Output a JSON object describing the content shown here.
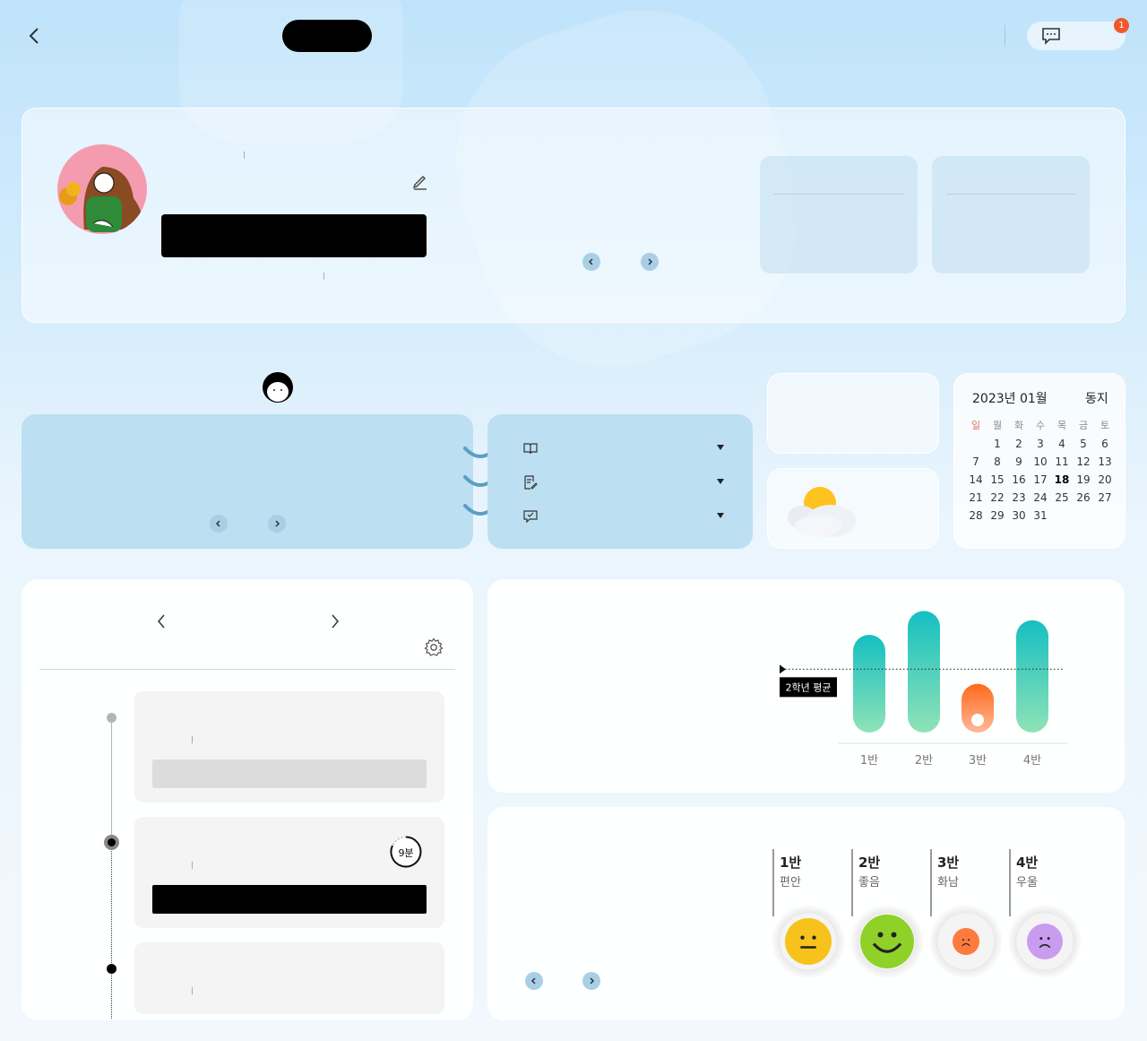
{
  "header": {
    "back_icon": "chevron-left-icon",
    "chat_icon": "chat-bubble-icon",
    "notification_count": "1"
  },
  "profile": {
    "avatar": "illustrated-avatar",
    "edit_icon": "pencil-icon"
  },
  "calendar": {
    "title": "2023년 01월",
    "solar_term": "동지",
    "weekdays": [
      "일",
      "월",
      "화",
      "수",
      "목",
      "금",
      "토"
    ],
    "days": [
      "",
      "1",
      "2",
      "3",
      "4",
      "5",
      "6",
      "7",
      "8",
      "9",
      "10",
      "11",
      "12",
      "13",
      "14",
      "15",
      "16",
      "17",
      "18",
      "19",
      "20",
      "21",
      "22",
      "23",
      "24",
      "25",
      "26",
      "27",
      "28",
      "29",
      "30",
      "31"
    ],
    "today": "18",
    "sunday_color": "#e8705a"
  },
  "weather": {
    "icon": "partly-cloudy-icon"
  },
  "class_menu": {
    "items": [
      {
        "icon": "book-icon"
      },
      {
        "icon": "edit-note-icon"
      },
      {
        "icon": "check-message-icon"
      }
    ]
  },
  "timetable": {
    "timer_label": "9분",
    "settings_icon": "gear-icon"
  },
  "chart_data": {
    "type": "bar",
    "categories": [
      "1반",
      "2반",
      "3반",
      "4반"
    ],
    "values": [
      82,
      100,
      45,
      93
    ],
    "reference_label": "2학년 평균",
    "reference_value": 56,
    "ylim": [
      0,
      105
    ],
    "colors": {
      "above": "#15bfc2",
      "above_end": "#8fe3b6",
      "below": "#ff6a1a",
      "below_end": "#ffb89a"
    },
    "grid": false
  },
  "mood": {
    "classes": [
      {
        "name": "1반",
        "state": "편안",
        "face": "neutral",
        "color": "#f7c21b"
      },
      {
        "name": "2반",
        "state": "좋음",
        "face": "happy",
        "color": "#8fd129"
      },
      {
        "name": "3반",
        "state": "화남",
        "face": "angry",
        "color": "#ff7a3d"
      },
      {
        "name": "4반",
        "state": "우울",
        "face": "sad",
        "color": "#c99cf0"
      }
    ]
  }
}
